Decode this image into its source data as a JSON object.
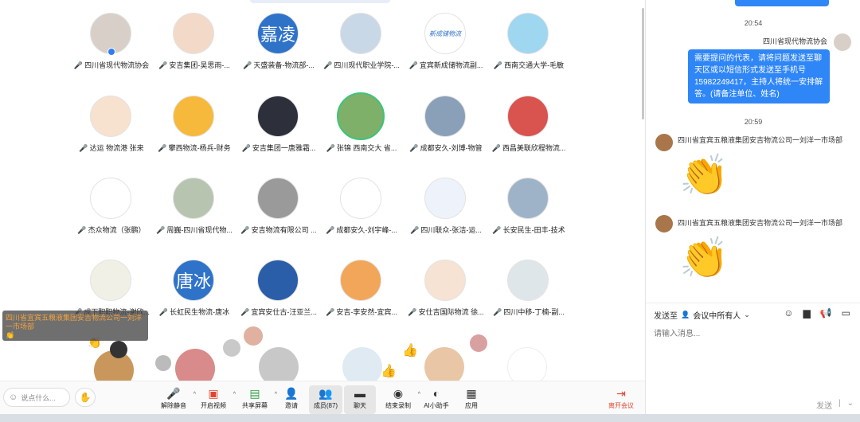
{
  "participants": [
    {
      "name": "四川省现代物流协会",
      "avatar_text": "",
      "avatar_color": "#d8cfc8",
      "host": true
    },
    {
      "name": "安吉集团-吴思雨-...",
      "avatar_text": "",
      "avatar_color": "#f3d9c8"
    },
    {
      "name": "天盛装备-物流部-...",
      "avatar_text": "嘉凌",
      "avatar_color": "#2f73c9"
    },
    {
      "name": "四川现代职业学院-...",
      "avatar_text": "",
      "avatar_color": "#c9d8e6"
    },
    {
      "name": "宜宾新成储物流副...",
      "avatar_text": "新成储物流",
      "avatar_color": "#ffffff"
    },
    {
      "name": "西南交通大学-毛敏",
      "avatar_text": "",
      "avatar_color": "#9fd6f0"
    },
    {
      "name": "达运 物流港 张来",
      "avatar_text": "",
      "avatar_color": "#f7e2cf"
    },
    {
      "name": "攀西物流-杨兵-财务",
      "avatar_text": "",
      "avatar_color": "#f6b93b"
    },
    {
      "name": "安吉集团一唐雅霜...",
      "avatar_text": "",
      "avatar_color": "#2d2f3a"
    },
    {
      "name": "张锦 西南交大 省...",
      "avatar_text": "",
      "avatar_color": "#7fb069",
      "speaking": true
    },
    {
      "name": "成都安久-刘博-物管",
      "avatar_text": "",
      "avatar_color": "#8aa0b8"
    },
    {
      "name": "西昌美联欣程物流...",
      "avatar_text": "",
      "avatar_color": "#d9534f"
    },
    {
      "name": "杰众物流（张鹏）",
      "avatar_text": "",
      "avatar_color": "#ffffff"
    },
    {
      "name": "周巍-四川省现代物...",
      "avatar_text": "",
      "avatar_color": "#b7c4b0"
    },
    {
      "name": "安吉物流有限公司 ...",
      "avatar_text": "",
      "avatar_color": "#9a9a9a"
    },
    {
      "name": "成都安久-刘宇峰-...",
      "avatar_text": "",
      "avatar_color": "#ffffff"
    },
    {
      "name": "四川联众-张洁-运...",
      "avatar_text": "",
      "avatar_color": "#eef3fb"
    },
    {
      "name": "长安民生-田丰-技术",
      "avatar_text": "",
      "avatar_color": "#9fb3c8"
    },
    {
      "name": "成下职职物流-谢欣...",
      "avatar_text": "",
      "avatar_color": "#f0f0e6"
    },
    {
      "name": "长虹民生物流-唐冰",
      "avatar_text": "唐冰",
      "avatar_color": "#2f73c9"
    },
    {
      "name": "宜宾安仕古-汪亚兰...",
      "avatar_text": "",
      "avatar_color": "#2b5ea8"
    },
    {
      "name": "安吉-李安然-宜宾...",
      "avatar_text": "",
      "avatar_color": "#f2a65a"
    },
    {
      "name": "安仕吉国际物流 徐...",
      "avatar_text": "",
      "avatar_color": "#f6e3d3"
    },
    {
      "name": "四川中移-丁楠-副...",
      "avatar_text": "",
      "avatar_color": "#dfe6e9"
    }
  ],
  "float_message": {
    "sender": "四川省宜宾五粮液集团安吉物流公司一刘洋一市场部",
    "emoji": "👏"
  },
  "toolbar": {
    "say_placeholder": "说点什么...",
    "mute": "解除静音",
    "video": "开启视频",
    "share": "共享屏幕",
    "invite": "邀请",
    "members": "成员(87)",
    "chat": "聊天",
    "record": "结束录制",
    "ai": "AI小助手",
    "apps": "应用",
    "leave": "离开会议"
  },
  "chat": {
    "time1": "20:54",
    "sender1": "四川省现代物流协会",
    "message1": "需要提问的代表，请将问题发送至聊天区或以短信形式发送至手机号15982249417，主持人将统一安排解答。(请备注单位、姓名)",
    "time2": "20:59",
    "sender2": "四川省宜宾五粮液集团安吉物流公司一刘洋一市场部",
    "emoji2": "👏",
    "sender3": "四川省宜宾五粮液集团安吉物流公司一刘洋一市场部",
    "emoji3": "👏",
    "send_to_label": "发送至",
    "send_to_target": "会议中所有人",
    "input_placeholder": "请输入消息...",
    "send_label": "发送"
  }
}
